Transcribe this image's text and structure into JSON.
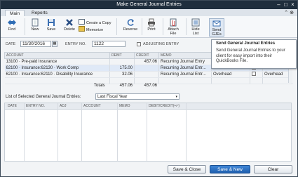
{
  "window": {
    "title": "Make General Journal Entries",
    "controls": {
      "minimize": "–",
      "maximize": "□",
      "close": "×"
    }
  },
  "tabs": [
    {
      "label": "Main"
    },
    {
      "label": "Reports"
    }
  ],
  "tab_actions": {
    "collapse": "⌃",
    "close": "⊗"
  },
  "ribbon": {
    "find": "Find",
    "new": "New",
    "save": "Save",
    "delete": "Delete",
    "create_copy": "Create a Copy",
    "memorize": "Memorize",
    "reverse": "Reverse",
    "print": "Print",
    "attach_file": "Attach File",
    "hide_list": "Hide List",
    "send_gjes": "Send GJEs"
  },
  "form": {
    "date_label": "DATE",
    "date_value": "11/30/2016",
    "entry_no_label": "ENTRY NO.",
    "entry_no_value": "1122",
    "adjusting_label": "ADJUSTING ENTRY"
  },
  "tooltip": {
    "title": "Send General Journal Entries",
    "text": "Send General Journal Entries to your client for easy import into their QuickBooks File."
  },
  "grid": {
    "headers": [
      "ACCOUNT",
      "DEBIT",
      "CREDIT",
      "MEMO",
      "",
      "",
      ""
    ],
    "rows": [
      {
        "account": "13100 · Pre-paid Insurance",
        "debit": "",
        "credit": "457.06",
        "memo": "Recurring Journal Entry",
        "name": "",
        "billable": "",
        "class": ""
      },
      {
        "account": "62100 · Insurance:62130 · Work Comp",
        "debit": "175.00",
        "credit": "",
        "memo": "Recurring Journal Entr...",
        "name": "Overhead",
        "billable": "",
        "class": "Overhead"
      },
      {
        "account": "62100 · Insurance:62110 · Disability Insurance",
        "debit": "32.06",
        "credit": "",
        "memo": "Recurring Journal Entr...",
        "name": "Overhead",
        "billable": "",
        "class": "Overhead"
      }
    ],
    "totals_label": "Totals",
    "total_debit": "457.06",
    "total_credit": "457.06"
  },
  "list": {
    "label": "List of Selected General Journal Entries:",
    "filter_value": "Last Fiscal Year",
    "headers": [
      "DATE",
      "ENTRY NO.",
      "ADJ",
      "ACCOUNT",
      "MEMO",
      "DEBIT/CREDIT(+/-)"
    ]
  },
  "buttons": {
    "save_close": "Save & Close",
    "save_new": "Save & New",
    "clear": "Clear"
  }
}
